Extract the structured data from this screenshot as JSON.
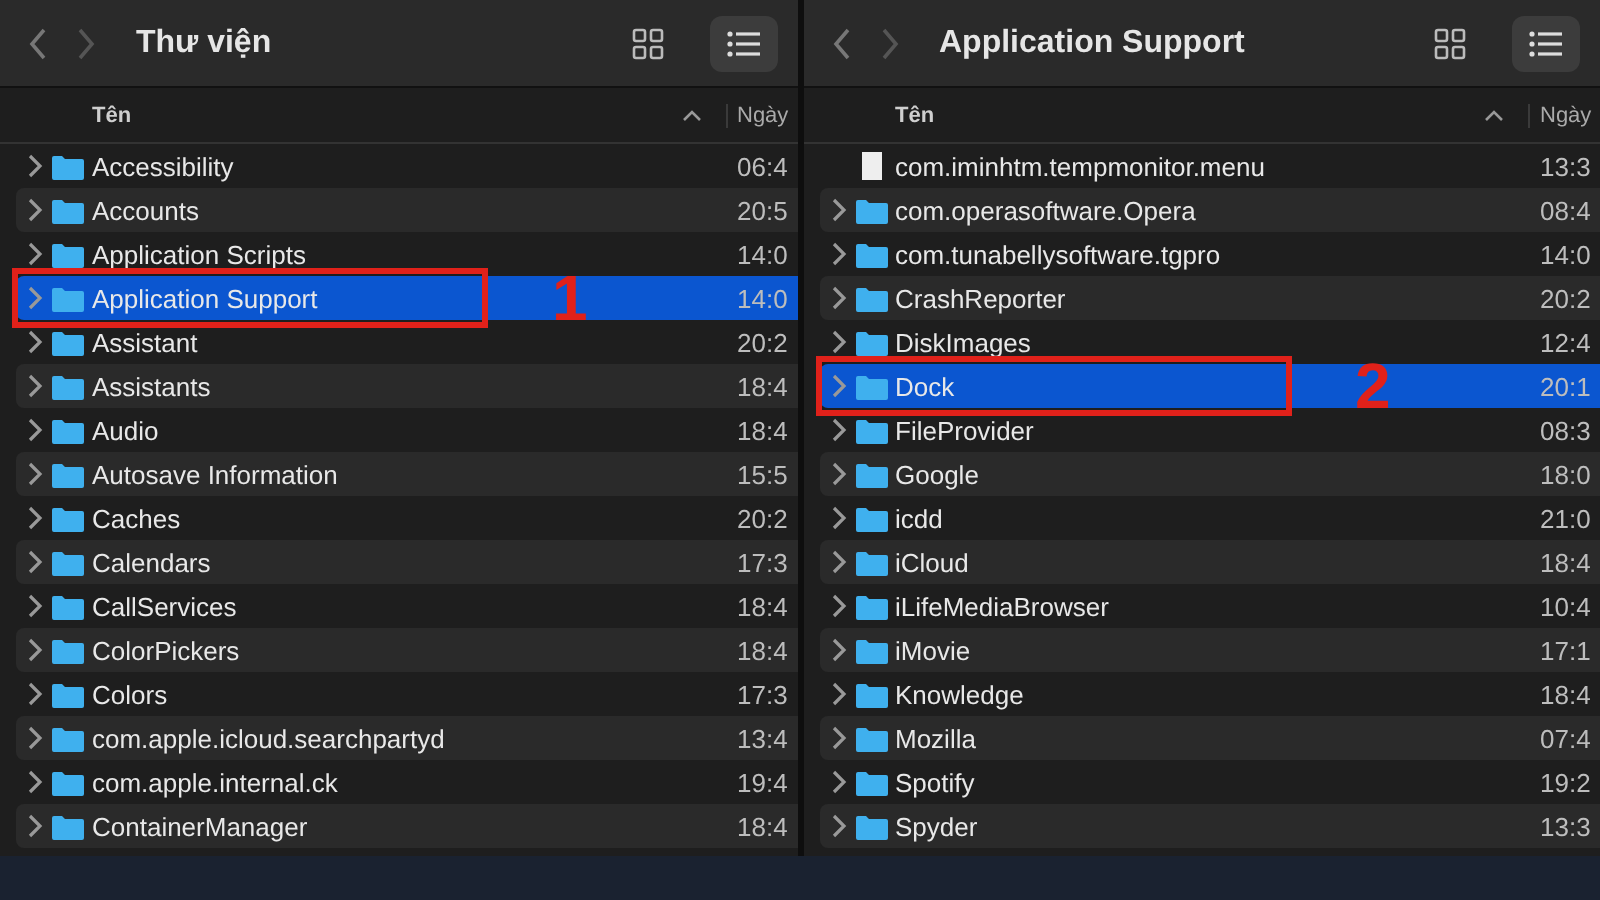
{
  "panes": [
    {
      "title": "Thư viện",
      "columns": [
        "Tên",
        "Ngày"
      ],
      "rows": [
        {
          "kind": "folder",
          "name": "Accessibility",
          "date": "06:4",
          "selected": false
        },
        {
          "kind": "folder",
          "name": "Accounts",
          "date": "20:5",
          "selected": false
        },
        {
          "kind": "folder",
          "name": "Application Scripts",
          "date": "14:0",
          "selected": false
        },
        {
          "kind": "folder",
          "name": "Application Support",
          "date": "14:0",
          "selected": true,
          "callout": "1"
        },
        {
          "kind": "folder",
          "name": "Assistant",
          "date": "20:2",
          "selected": false
        },
        {
          "kind": "folder",
          "name": "Assistants",
          "date": "18:4",
          "selected": false
        },
        {
          "kind": "folder",
          "name": "Audio",
          "date": "18:4",
          "selected": false
        },
        {
          "kind": "folder",
          "name": "Autosave Information",
          "date": "15:5",
          "selected": false
        },
        {
          "kind": "folder",
          "name": "Caches",
          "date": "20:2",
          "selected": false
        },
        {
          "kind": "folder",
          "name": "Calendars",
          "date": "17:3",
          "selected": false
        },
        {
          "kind": "folder",
          "name": "CallServices",
          "date": "18:4",
          "selected": false
        },
        {
          "kind": "folder",
          "name": "ColorPickers",
          "date": "18:4",
          "selected": false
        },
        {
          "kind": "folder",
          "name": "Colors",
          "date": "17:3",
          "selected": false
        },
        {
          "kind": "folder",
          "name": "com.apple.icloud.searchpartyd",
          "date": "13:4",
          "selected": false
        },
        {
          "kind": "folder",
          "name": "com.apple.internal.ck",
          "date": "19:4",
          "selected": false
        },
        {
          "kind": "folder",
          "name": "ContainerManager",
          "date": "18:4",
          "selected": false
        }
      ]
    },
    {
      "title": "Application Support",
      "columns": [
        "Tên",
        "Ngày"
      ],
      "rows": [
        {
          "kind": "file",
          "name": "com.iminhtm.tempmonitor.menu",
          "date": "13:3",
          "selected": false
        },
        {
          "kind": "folder",
          "name": "com.operasoftware.Opera",
          "date": "08:4",
          "selected": false
        },
        {
          "kind": "folder",
          "name": "com.tunabellysoftware.tgpro",
          "date": "14:0",
          "selected": false
        },
        {
          "kind": "folder",
          "name": "CrashReporter",
          "date": "20:2",
          "selected": false
        },
        {
          "kind": "folder",
          "name": "DiskImages",
          "date": "12:4",
          "selected": false
        },
        {
          "kind": "folder",
          "name": "Dock",
          "date": "20:1",
          "selected": true,
          "callout": "2"
        },
        {
          "kind": "folder",
          "name": "FileProvider",
          "date": "08:3",
          "selected": false
        },
        {
          "kind": "folder",
          "name": "Google",
          "date": "18:0",
          "selected": false
        },
        {
          "kind": "folder",
          "name": "icdd",
          "date": "21:0",
          "selected": false
        },
        {
          "kind": "folder",
          "name": "iCloud",
          "date": "18:4",
          "selected": false
        },
        {
          "kind": "folder",
          "name": "iLifeMediaBrowser",
          "date": "10:4",
          "selected": false
        },
        {
          "kind": "folder",
          "name": "iMovie",
          "date": "17:1",
          "selected": false
        },
        {
          "kind": "folder",
          "name": "Knowledge",
          "date": "18:4",
          "selected": false
        },
        {
          "kind": "folder",
          "name": "Mozilla",
          "date": "07:4",
          "selected": false
        },
        {
          "kind": "folder",
          "name": "Spotify",
          "date": "19:2",
          "selected": false
        },
        {
          "kind": "folder",
          "name": "Spyder",
          "date": "13:3",
          "selected": false
        }
      ]
    }
  ]
}
